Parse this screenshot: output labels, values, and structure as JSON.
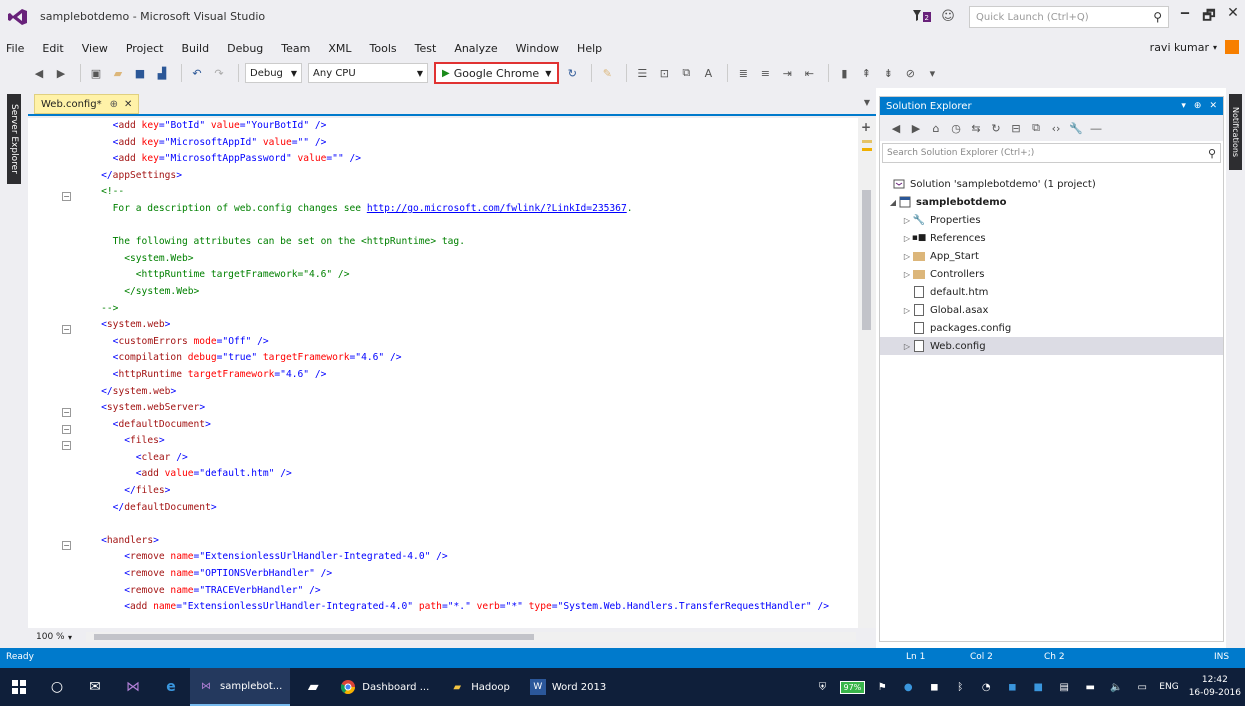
{
  "window": {
    "title": "samplebotdemo - Microsoft Visual Studio",
    "quick_launch_placeholder": "Quick Launch (Ctrl+Q)",
    "minimize": "‒",
    "restore": "🗗",
    "close": "✕"
  },
  "menu": {
    "items": [
      "File",
      "Edit",
      "View",
      "Project",
      "Build",
      "Debug",
      "Team",
      "XML",
      "Tools",
      "Test",
      "Analyze",
      "Window",
      "Help"
    ],
    "user": "ravi kumar"
  },
  "toolbar": {
    "config": "Debug",
    "platform": "Any CPU",
    "run_target": "Google Chrome"
  },
  "left_panel": {
    "server_explorer": "Server Explorer"
  },
  "right_panel": {
    "notifications": "Notifications"
  },
  "editor": {
    "tab_title": "Web.config*",
    "zoom": "100 %",
    "lines": [
      {
        "indent": "      ",
        "parts": [
          [
            "b",
            "<"
          ],
          [
            "t",
            "add"
          ],
          [
            "a",
            " key"
          ],
          [
            "b",
            "=\""
          ],
          [
            "v",
            "BotId"
          ],
          [
            "b",
            "\""
          ],
          [
            "a",
            " value"
          ],
          [
            "b",
            "=\""
          ],
          [
            "v",
            "YourBotId"
          ],
          [
            "b",
            "\" />"
          ]
        ]
      },
      {
        "indent": "      ",
        "parts": [
          [
            "b",
            "<"
          ],
          [
            "t",
            "add"
          ],
          [
            "a",
            " key"
          ],
          [
            "b",
            "=\""
          ],
          [
            "v",
            "MicrosoftAppId"
          ],
          [
            "b",
            "\""
          ],
          [
            "a",
            " value"
          ],
          [
            "b",
            "=\"\" />"
          ]
        ]
      },
      {
        "indent": "      ",
        "parts": [
          [
            "b",
            "<"
          ],
          [
            "t",
            "add"
          ],
          [
            "a",
            " key"
          ],
          [
            "b",
            "=\""
          ],
          [
            "v",
            "MicrosoftAppPassword"
          ],
          [
            "b",
            "\""
          ],
          [
            "a",
            " value"
          ],
          [
            "b",
            "=\"\" />"
          ]
        ]
      },
      {
        "indent": "    ",
        "parts": [
          [
            "b",
            "</"
          ],
          [
            "t",
            "appSettings"
          ],
          [
            "b",
            ">"
          ]
        ]
      },
      {
        "indent": "    ",
        "parts": [
          [
            "c",
            "<!--"
          ]
        ]
      },
      {
        "indent": "      ",
        "parts": [
          [
            "c",
            "For a description of web.config changes see "
          ],
          [
            "l",
            "http://go.microsoft.com/fwlink/?LinkId=235367"
          ],
          [
            "c",
            "."
          ]
        ]
      },
      {
        "indent": "",
        "parts": []
      },
      {
        "indent": "      ",
        "parts": [
          [
            "c",
            "The following attributes can be set on the <httpRuntime> tag."
          ]
        ]
      },
      {
        "indent": "        ",
        "parts": [
          [
            "c",
            "<system.Web>"
          ]
        ]
      },
      {
        "indent": "          ",
        "parts": [
          [
            "c",
            "<httpRuntime targetFramework=\"4.6\" />"
          ]
        ]
      },
      {
        "indent": "        ",
        "parts": [
          [
            "c",
            "</system.Web>"
          ]
        ]
      },
      {
        "indent": "    ",
        "parts": [
          [
            "c",
            "-->"
          ]
        ]
      },
      {
        "indent": "    ",
        "parts": [
          [
            "b",
            "<"
          ],
          [
            "t",
            "system.web"
          ],
          [
            "b",
            ">"
          ]
        ]
      },
      {
        "indent": "      ",
        "parts": [
          [
            "b",
            "<"
          ],
          [
            "t",
            "customErrors"
          ],
          [
            "a",
            " mode"
          ],
          [
            "b",
            "=\""
          ],
          [
            "v",
            "Off"
          ],
          [
            "b",
            "\" />"
          ]
        ]
      },
      {
        "indent": "      ",
        "parts": [
          [
            "b",
            "<"
          ],
          [
            "t",
            "compilation"
          ],
          [
            "a",
            " debug"
          ],
          [
            "b",
            "=\""
          ],
          [
            "v",
            "true"
          ],
          [
            "b",
            "\""
          ],
          [
            "a",
            " targetFramework"
          ],
          [
            "b",
            "=\""
          ],
          [
            "v",
            "4.6"
          ],
          [
            "b",
            "\" />"
          ]
        ]
      },
      {
        "indent": "      ",
        "parts": [
          [
            "b",
            "<"
          ],
          [
            "t",
            "httpRuntime"
          ],
          [
            "a",
            " targetFramework"
          ],
          [
            "b",
            "=\""
          ],
          [
            "v",
            "4.6"
          ],
          [
            "b",
            "\" />"
          ]
        ]
      },
      {
        "indent": "    ",
        "parts": [
          [
            "b",
            "</"
          ],
          [
            "t",
            "system.web"
          ],
          [
            "b",
            ">"
          ]
        ]
      },
      {
        "indent": "    ",
        "parts": [
          [
            "b",
            "<"
          ],
          [
            "t",
            "system.webServer"
          ],
          [
            "b",
            ">"
          ]
        ]
      },
      {
        "indent": "      ",
        "parts": [
          [
            "b",
            "<"
          ],
          [
            "t",
            "defaultDocument"
          ],
          [
            "b",
            ">"
          ]
        ]
      },
      {
        "indent": "        ",
        "parts": [
          [
            "b",
            "<"
          ],
          [
            "t",
            "files"
          ],
          [
            "b",
            ">"
          ]
        ]
      },
      {
        "indent": "          ",
        "parts": [
          [
            "b",
            "<"
          ],
          [
            "t",
            "clear"
          ],
          [
            "b",
            " />"
          ]
        ]
      },
      {
        "indent": "          ",
        "parts": [
          [
            "b",
            "<"
          ],
          [
            "t",
            "add"
          ],
          [
            "a",
            " value"
          ],
          [
            "b",
            "=\""
          ],
          [
            "v",
            "default.htm"
          ],
          [
            "b",
            "\" />"
          ]
        ]
      },
      {
        "indent": "        ",
        "parts": [
          [
            "b",
            "</"
          ],
          [
            "t",
            "files"
          ],
          [
            "b",
            ">"
          ]
        ]
      },
      {
        "indent": "      ",
        "parts": [
          [
            "b",
            "</"
          ],
          [
            "t",
            "defaultDocument"
          ],
          [
            "b",
            ">"
          ]
        ]
      },
      {
        "indent": "",
        "parts": []
      },
      {
        "indent": "    ",
        "parts": [
          [
            "b",
            "<"
          ],
          [
            "t",
            "handlers"
          ],
          [
            "b",
            ">"
          ]
        ]
      },
      {
        "indent": "        ",
        "parts": [
          [
            "b",
            "<"
          ],
          [
            "t",
            "remove"
          ],
          [
            "a",
            " name"
          ],
          [
            "b",
            "=\""
          ],
          [
            "v",
            "ExtensionlessUrlHandler-Integrated-4.0"
          ],
          [
            "b",
            "\" />"
          ]
        ]
      },
      {
        "indent": "        ",
        "parts": [
          [
            "b",
            "<"
          ],
          [
            "t",
            "remove"
          ],
          [
            "a",
            " name"
          ],
          [
            "b",
            "=\""
          ],
          [
            "v",
            "OPTIONSVerbHandler"
          ],
          [
            "b",
            "\" />"
          ]
        ]
      },
      {
        "indent": "        ",
        "parts": [
          [
            "b",
            "<"
          ],
          [
            "t",
            "remove"
          ],
          [
            "a",
            " name"
          ],
          [
            "b",
            "=\""
          ],
          [
            "v",
            "TRACEVerbHandler"
          ],
          [
            "b",
            "\" />"
          ]
        ]
      },
      {
        "indent": "        ",
        "parts": [
          [
            "b",
            "<"
          ],
          [
            "t",
            "add"
          ],
          [
            "a",
            " name"
          ],
          [
            "b",
            "=\""
          ],
          [
            "v",
            "ExtensionlessUrlHandler-Integrated-4.0"
          ],
          [
            "b",
            "\""
          ],
          [
            "a",
            " path"
          ],
          [
            "b",
            "=\""
          ],
          [
            "v",
            "*."
          ],
          [
            "b",
            "\""
          ],
          [
            "a",
            " verb"
          ],
          [
            "b",
            "=\""
          ],
          [
            "v",
            "*"
          ],
          [
            "b",
            "\""
          ],
          [
            "a",
            " type"
          ],
          [
            "b",
            "=\""
          ],
          [
            "v",
            "System.Web.Handlers.TransferRequestHandler"
          ],
          [
            "b",
            "\" />"
          ]
        ]
      }
    ]
  },
  "solution_explorer": {
    "title": "Solution Explorer",
    "search_placeholder": "Search Solution Explorer (Ctrl+;)",
    "nodes": [
      {
        "label": "Solution 'samplebotdemo' (1 project)",
        "icon": "solution-icon"
      },
      {
        "label": "samplebotdemo",
        "icon": "project-icon"
      },
      {
        "label": "Properties",
        "icon": "wrench-icon"
      },
      {
        "label": "References",
        "icon": "references-icon"
      },
      {
        "label": "App_Start",
        "icon": "folder-icon"
      },
      {
        "label": "Controllers",
        "icon": "folder-icon"
      },
      {
        "label": "default.htm",
        "icon": "file-icon"
      },
      {
        "label": "Global.asax",
        "icon": "file-icon"
      },
      {
        "label": "packages.config",
        "icon": "config-file-icon"
      },
      {
        "label": "Web.config",
        "icon": "config-file-icon"
      }
    ]
  },
  "status": {
    "ready": "Ready",
    "ln": "Ln 1",
    "col": "Col 2",
    "ch": "Ch 2",
    "ins": "INS"
  },
  "taskbar": {
    "apps": [
      "samplebot...",
      "Dashboard ...",
      "Hadoop",
      "Word 2013"
    ],
    "battery": "97%",
    "lang": "ENG",
    "time": "12:42",
    "date": "16-09-2016"
  },
  "colors": {
    "accent": "#007acc",
    "tag": "#a31515",
    "attr": "#ff0000",
    "value": "#0000ff",
    "comment": "#008000",
    "run_highlight": "#e03232"
  }
}
